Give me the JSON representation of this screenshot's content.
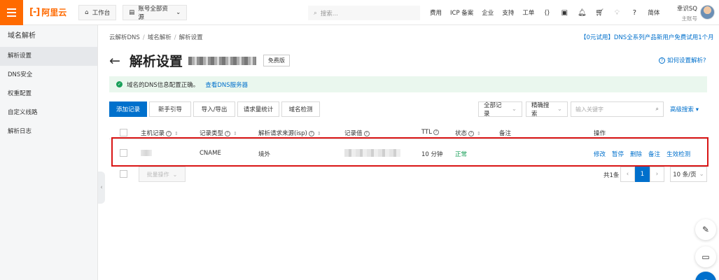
{
  "colors": {
    "brand": "#ff6a00",
    "primary": "#0070cc",
    "success": "#1aa05a",
    "highlight": "#d91515"
  },
  "header": {
    "logo_text": "阿里云",
    "workbench_label": "工作台",
    "resources_label": "账号全部资源",
    "search_placeholder": "搜索...",
    "nav_links": [
      "费用",
      "ICP 备案",
      "企业",
      "支持",
      "工单"
    ],
    "lang_label": "简体",
    "user_name": "幸识SQ",
    "user_role": "主账号"
  },
  "sidebar": {
    "title": "域名解析",
    "items": [
      {
        "label": "解析设置",
        "active": true
      },
      {
        "label": "DNS安全"
      },
      {
        "label": "权重配置"
      },
      {
        "label": "自定义线路"
      },
      {
        "label": "解析日志"
      }
    ]
  },
  "breadcrumb": [
    "云解析DNS",
    "域名解析",
    "解析设置"
  ],
  "promo_text": "【0元试用】DNS全系列产品新用户免费试用1个月",
  "page": {
    "title": "解析设置",
    "edition_tag": "免费版",
    "help_link": "如何设置解析?"
  },
  "notice": {
    "text": "域名的DNS信息配置正确。",
    "link": "查看DNS服务器"
  },
  "toolbar": {
    "buttons": [
      "添加记录",
      "新手引导",
      "导入/导出",
      "请求量统计",
      "域名检测"
    ],
    "filter_select": "全部记录",
    "search_type": "精确搜索",
    "keyword_placeholder": "输入关键字",
    "advanced_search": "高级搜索"
  },
  "table": {
    "headers": {
      "host": "主机记录",
      "type": "记录类型",
      "isp": "解析请求来源(isp)",
      "value": "记录值",
      "ttl": "TTL",
      "status": "状态",
      "remark": "备注",
      "ops": "操作"
    },
    "rows": [
      {
        "type": "CNAME",
        "isp": "境外",
        "ttl": "10 分钟",
        "status": "正常",
        "ops": [
          "修改",
          "暂停",
          "删除",
          "备注",
          "生效检测"
        ]
      }
    ]
  },
  "footer": {
    "batch_label": "批量操作",
    "total": "共1条",
    "current_page": "1",
    "page_size": "10 条/页"
  }
}
